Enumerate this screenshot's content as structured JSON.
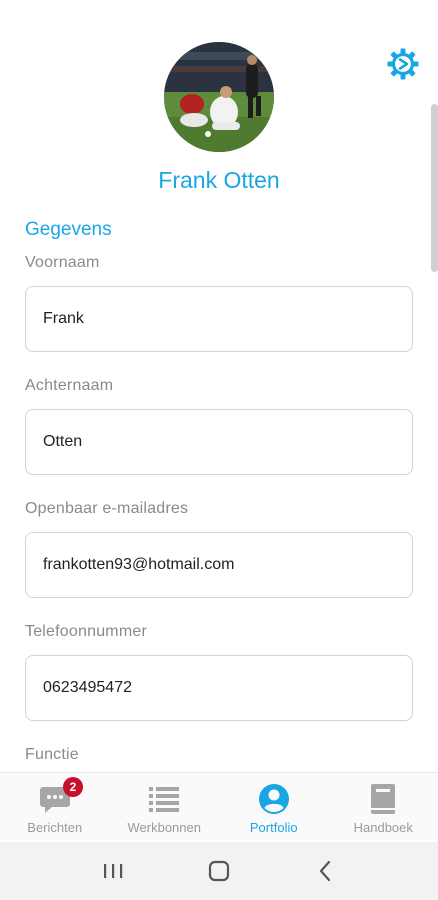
{
  "profile": {
    "name": "Frank Otten"
  },
  "section": {
    "title": "Gegevens"
  },
  "fields": [
    {
      "label": "Voornaam",
      "value": "Frank"
    },
    {
      "label": "Achternaam",
      "value": "Otten"
    },
    {
      "label": "Openbaar e-mailadres",
      "value": "frankotten93@hotmail.com"
    },
    {
      "label": "Telefoonnummer",
      "value": "0623495472"
    },
    {
      "label": "Functie",
      "value": ""
    }
  ],
  "tabs": [
    {
      "label": "Berichten",
      "icon": "chat-icon",
      "badge": "2",
      "active": false
    },
    {
      "label": "Werkbonnen",
      "icon": "list-icon",
      "active": false
    },
    {
      "label": "Portfolio",
      "icon": "person-icon",
      "active": true
    },
    {
      "label": "Handboek",
      "icon": "book-icon",
      "active": false
    }
  ],
  "colors": {
    "accent": "#1aa6e3",
    "badge": "#c8102e",
    "muted_icon": "#9a9a9a"
  }
}
